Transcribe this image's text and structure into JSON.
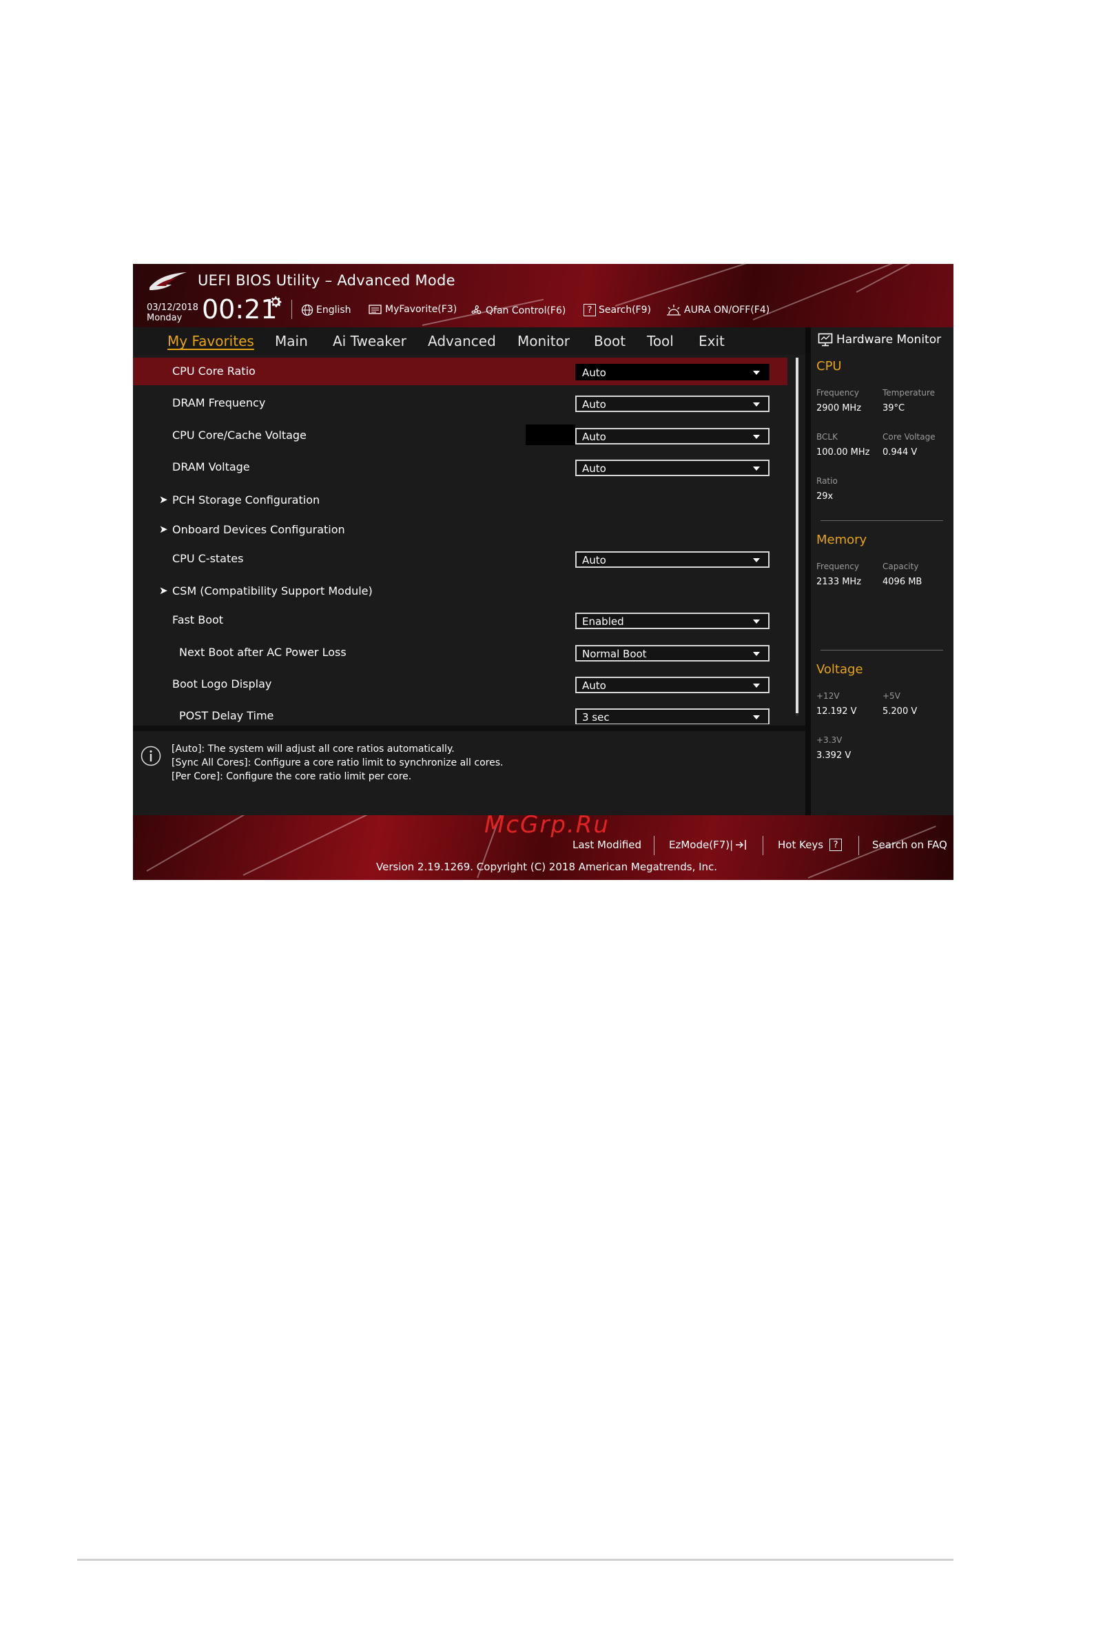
{
  "header": {
    "title": "UEFI BIOS Utility – Advanced Mode",
    "date": "03/12/2018",
    "day": "Monday",
    "time": "00:21",
    "tools": [
      {
        "label": "English",
        "icon": "globe-icon"
      },
      {
        "label": "MyFavorite(F3)",
        "icon": "favorite-icon"
      },
      {
        "label": "Qfan Control(F6)",
        "icon": "fan-icon"
      },
      {
        "label": "Search(F9)",
        "icon": "search-help-icon"
      },
      {
        "label": "AURA ON/OFF(F4)",
        "icon": "aura-icon"
      }
    ]
  },
  "tabs": [
    "My Favorites",
    "Main",
    "Ai Tweaker",
    "Advanced",
    "Monitor",
    "Boot",
    "Tool",
    "Exit"
  ],
  "active_tab": "My Favorites",
  "settings": [
    {
      "label": "CPU Core Ratio",
      "value": "Auto"
    },
    {
      "label": "DRAM Frequency",
      "value": "Auto"
    },
    {
      "label": "CPU Core/Cache Voltage",
      "value": "Auto"
    },
    {
      "label": "DRAM Voltage",
      "value": "Auto"
    },
    {
      "label": "PCH Storage Configuration"
    },
    {
      "label": "Onboard Devices Configuration"
    },
    {
      "label": "CPU C-states",
      "value": "Auto"
    },
    {
      "label": "CSM (Compatibility Support Module)"
    },
    {
      "label": "Fast Boot",
      "value": "Enabled"
    },
    {
      "label": "Next Boot after AC Power Loss",
      "value": "Normal Boot"
    },
    {
      "label": "Boot Logo Display",
      "value": "Auto"
    },
    {
      "label": "POST Delay Time",
      "value": "3 sec"
    }
  ],
  "help": [
    "[Auto]: The system will adjust all core ratios automatically.",
    "[Sync All Cores]: Configure a core ratio limit to synchronize all cores.",
    "[Per Core]: Configure the core ratio limit per core."
  ],
  "hardware_monitor": {
    "title": "Hardware Monitor",
    "cpu": {
      "heading": "CPU",
      "frequency_label": "Frequency",
      "frequency": "2900 MHz",
      "temperature_label": "Temperature",
      "temperature": "39°C",
      "bclk_label": "BCLK",
      "bclk": "100.00 MHz",
      "core_voltage_label": "Core Voltage",
      "core_voltage": "0.944 V",
      "ratio_label": "Ratio",
      "ratio": "29x"
    },
    "memory": {
      "heading": "Memory",
      "frequency_label": "Frequency",
      "frequency": "2133 MHz",
      "capacity_label": "Capacity",
      "capacity": "4096 MB"
    },
    "voltage": {
      "heading": "Voltage",
      "v12_label": "+12V",
      "v12": "12.192 V",
      "v5_label": "+5V",
      "v5": "5.200 V",
      "v33_label": "+3.3V",
      "v33": "3.392 V"
    }
  },
  "footer": {
    "last_modified": "Last Modified",
    "ezmode": "EzMode(F7)|",
    "hot_keys": "Hot Keys",
    "search_faq": "Search on FAQ",
    "version": "Version 2.19.1269. Copyright (C) 2018 American Megatrends, Inc.",
    "watermark": "McGrp.Ru"
  }
}
